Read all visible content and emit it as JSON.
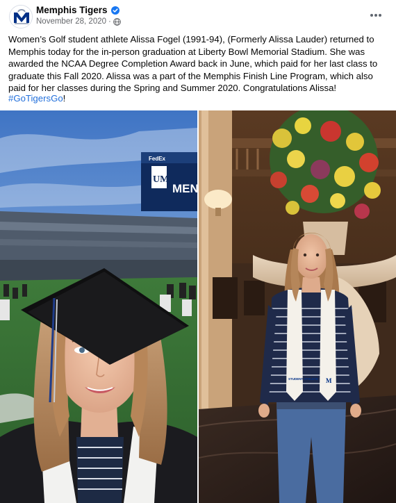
{
  "post": {
    "author": "Memphis Tigers",
    "timestamp": "November 28, 2020",
    "privacy_icon": "globe-icon",
    "verified_icon": "verified-badge-icon",
    "more_icon": "more-options-icon",
    "text": "Women’s Golf student athlete Alissa Fogel (1991-94),  (Formerly Alissa Lauder) returned to Memphis today for the in-person graduation at Liberty Bowl Memorial Stadium.  She was awarded the NCAA Degree Completion Award back in June, which paid for her last class to graduate this Fall 2020.  Alissa was a part of the Memphis Finish Line Program, which also paid for her classes during the Spring and Summer 2020.  Congratulations Alissa!",
    "hashtag": "#GoTigersGo",
    "hashtag_suffix": "!"
  },
  "photos": {
    "left": {
      "scoreboard_sponsor": "FedEx",
      "scoreboard_logo": "UM",
      "scoreboard_text": "MEN"
    },
    "right": {
      "stole_text": "STUDENT ATHLETE",
      "stole_logo": "M"
    }
  },
  "colors": {
    "brand_blue": "#003087",
    "link_blue": "#216fdb",
    "verified_blue": "#1877f2",
    "muted_text": "#65676b"
  }
}
